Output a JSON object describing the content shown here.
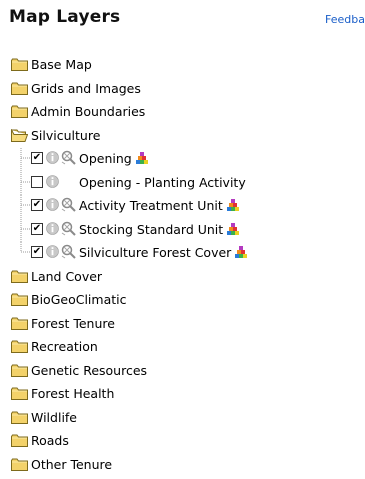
{
  "header": {
    "title": "Map Layers",
    "feedback_link": "Feedba"
  },
  "folders": {
    "base_map": "Base Map",
    "grids_images": "Grids and Images",
    "admin_boundaries": "Admin Boundaries",
    "silviculture": "Silviculture",
    "land_cover": "Land Cover",
    "biogeoclimatic": "BioGeoClimatic",
    "forest_tenure": "Forest Tenure",
    "recreation": "Recreation",
    "genetic_resources": "Genetic Resources",
    "forest_health": "Forest Health",
    "wildlife": "Wildlife",
    "roads": "Roads",
    "other_tenure": "Other Tenure"
  },
  "silviculture_layers": [
    {
      "label": "Opening",
      "checked": true,
      "has_tool": true,
      "has_legend": true
    },
    {
      "label": "Opening - Planting Activity",
      "checked": false,
      "has_tool": false,
      "has_legend": false
    },
    {
      "label": "Activity Treatment Unit",
      "checked": true,
      "has_tool": true,
      "has_legend": true
    },
    {
      "label": "Stocking Standard Unit",
      "checked": true,
      "has_tool": true,
      "has_legend": true
    },
    {
      "label": "Silviculture Forest Cover",
      "checked": true,
      "has_tool": true,
      "has_legend": true
    }
  ],
  "icons": {
    "folder_closed": "folder-icon",
    "folder_open": "folder-open-icon",
    "info": "info-icon",
    "identify_tool": "identify-tool-icon",
    "legend": "legend-icon"
  },
  "colors": {
    "folder_fill": "#f5d66b",
    "folder_outline": "#8a7420",
    "link": "#1a5ec8"
  }
}
